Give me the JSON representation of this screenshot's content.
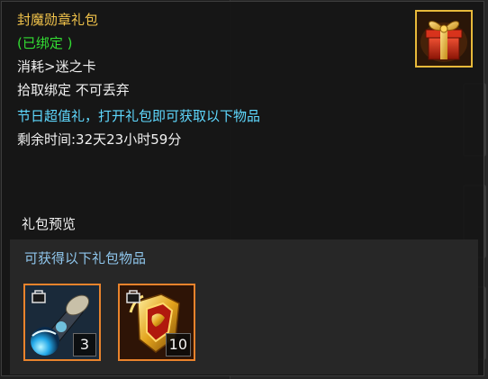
{
  "tooltip": {
    "title": "封魔勋章礼包",
    "bound_status": "(已绑定 )",
    "consume": "消耗>迷之卡",
    "bind_rule": "拾取绑定 不可丢弃",
    "description": "节日超值礼，打开礼包即可获取以下物品",
    "remaining_time": "剩余时间:32天23小时59分",
    "item_icon": "gift-box-icon"
  },
  "preview": {
    "header": "礼包预览",
    "caption": "可获得以下礼包物品",
    "items": [
      {
        "icon": "blue-cannon-icon",
        "count": "3"
      },
      {
        "icon": "gold-medal-icon",
        "count": "10"
      }
    ]
  },
  "colors": {
    "title": "#f0c24a",
    "bound": "#33dd33",
    "description": "#5fd9ff",
    "caption": "#8fc6ec",
    "icon_border": "#e7b93a",
    "slot_border": "#e9832c"
  }
}
